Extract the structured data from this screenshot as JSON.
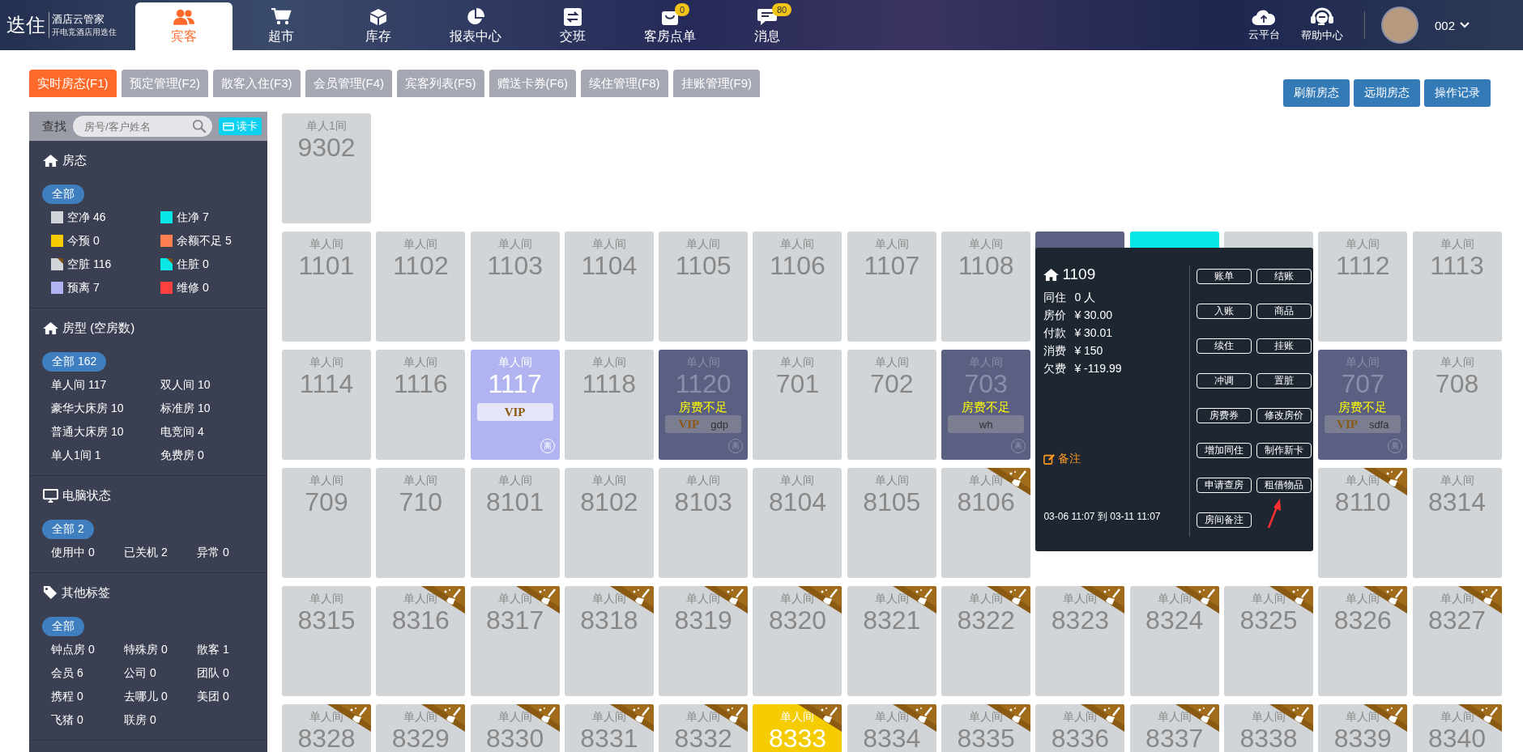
{
  "top_nav": {
    "logo": {
      "mark": "迭住",
      "name": "酒店云管家",
      "slogan": "开电竞酒店用迭住"
    },
    "items": [
      {
        "label": "宾客",
        "selected": true
      },
      {
        "label": "超市",
        "selected": false
      },
      {
        "label": "库存",
        "selected": false
      },
      {
        "label": "报表中心",
        "selected": false
      },
      {
        "label": "交班",
        "selected": false
      },
      {
        "label": "客房点单",
        "selected": false,
        "badge": "0"
      },
      {
        "label": "消息",
        "selected": false,
        "badge": "80"
      }
    ],
    "tools": [
      {
        "label": "云平台"
      },
      {
        "label": "帮助中心"
      }
    ],
    "user": {
      "name": "002"
    }
  },
  "tabs": [
    {
      "label": "实时房态(F1)",
      "selected": true
    },
    {
      "label": "预定管理(F2)",
      "selected": false
    },
    {
      "label": "散客入住(F3)",
      "selected": false
    },
    {
      "label": "会员管理(F4)",
      "selected": false
    },
    {
      "label": "宾客列表(F5)",
      "selected": false
    },
    {
      "label": "赠送卡券(F6)",
      "selected": false
    },
    {
      "label": "续住管理(F8)",
      "selected": false
    },
    {
      "label": "挂账管理(F9)",
      "selected": false
    }
  ],
  "actions": [
    "刷新房态",
    "远期房态",
    "操作记录"
  ],
  "sidebar": {
    "search": {
      "label": "查找",
      "placeholder": "房号/客户姓名"
    },
    "read_card": "读卡",
    "sections": [
      {
        "kind": "legend",
        "title": "房态",
        "all": {
          "label": "全部",
          "selected": true
        },
        "filters": [
          {
            "label": "空净 46",
            "color": "#d2d5d8",
            "dirty": false,
            "selected": false
          },
          {
            "label": "住净 7",
            "color": "#08e6e6",
            "dirty": false,
            "selected": false
          },
          {
            "label": "今预 0",
            "color": "#f5cc00",
            "dirty": false,
            "selected": false
          },
          {
            "label": "余额不足 5",
            "color": "#ff7f50",
            "dirty": false,
            "selected": false
          },
          {
            "label": "空脏 116",
            "color": "#d2d5d8",
            "dirty": true,
            "selected": false
          },
          {
            "label": "住脏 0",
            "color": "#08e6e6",
            "dirty": true,
            "selected": false
          },
          {
            "label": "预离 7",
            "color": "#b1b4f0",
            "dirty": false,
            "selected": false
          },
          {
            "label": "维修 0",
            "color": "#ff4040",
            "dirty": false,
            "selected": false
          }
        ]
      },
      {
        "kind": "types",
        "title": "房型 (空房数)",
        "all": {
          "label": "全部 162",
          "selected": true
        },
        "filters": [
          {
            "label": "单人间 117",
            "selected": false
          },
          {
            "label": "双人间 10",
            "selected": false
          },
          {
            "label": "豪华大床房 10",
            "selected": false
          },
          {
            "label": "标准房 10",
            "selected": false
          },
          {
            "label": "普通大床房 10",
            "selected": false
          },
          {
            "label": "电竞间 4",
            "selected": false
          },
          {
            "label": "单人1间 1",
            "selected": false
          },
          {
            "label": "免费房 0",
            "selected": false
          }
        ]
      },
      {
        "kind": "computers",
        "title": "电脑状态",
        "all": {
          "label": "全部 2",
          "selected": true
        },
        "filters": [
          {
            "label": "使用中 0",
            "selected": false
          },
          {
            "label": "已关机 2",
            "selected": false
          },
          {
            "label": "异常 0",
            "selected": false
          }
        ]
      },
      {
        "kind": "tags",
        "title": "其他标签",
        "all": {
          "label": "全部",
          "selected": true
        },
        "filters": [
          {
            "label": "钟点房 0",
            "selected": false
          },
          {
            "label": "特殊房 0",
            "selected": false
          },
          {
            "label": "散客 1",
            "selected": false
          },
          {
            "label": "会员 6",
            "selected": false
          },
          {
            "label": "公司 0",
            "selected": false
          },
          {
            "label": "团队 0",
            "selected": false
          },
          {
            "label": "携程 0",
            "selected": false
          },
          {
            "label": "去哪儿 0",
            "selected": false
          },
          {
            "label": "美团 0",
            "selected": false
          },
          {
            "label": "飞猪 0",
            "selected": false
          },
          {
            "label": "联房 0",
            "selected": false
          }
        ]
      }
    ]
  },
  "room_grid": {
    "rows": [
      [
        {
          "type": "单人1间",
          "number": "9302",
          "color": "#d2d5d8",
          "dirty": false
        }
      ],
      [
        {
          "type": "单人间",
          "number": "1101",
          "color": "#d2d5d8",
          "dirty": false
        },
        {
          "type": "单人间",
          "number": "1102",
          "color": "#d2d5d8",
          "dirty": false
        },
        {
          "type": "单人间",
          "number": "1103",
          "color": "#d2d5d8",
          "dirty": false
        },
        {
          "type": "单人间",
          "number": "1104",
          "color": "#d2d5d8",
          "dirty": false
        },
        {
          "type": "单人间",
          "number": "1105",
          "color": "#d2d5d8",
          "dirty": false
        },
        {
          "type": "单人间",
          "number": "1106",
          "color": "#d2d5d8",
          "dirty": false
        },
        {
          "type": "单人间",
          "number": "1107",
          "color": "#d2d5d8",
          "dirty": false
        },
        {
          "type": "单人间",
          "number": "1108",
          "color": "#d2d5d8",
          "dirty": false
        },
        {
          "color": "#5b5f82",
          "dirty": false
        },
        {
          "color": "#08e6e6",
          "dirty": false
        },
        {
          "color": "#d2d5d8",
          "dirty": false
        },
        {
          "type": "单人间",
          "number": "1112",
          "color": "#d2d5d8",
          "dirty": false
        },
        {
          "type": "单人间",
          "number": "1113",
          "color": "#d2d5d8",
          "dirty": false
        }
      ],
      [
        {
          "type": "单人间",
          "number": "1114",
          "color": "#d2d5d8",
          "dirty": false
        },
        {
          "type": "单人间",
          "number": "1116",
          "color": "#d2d5d8",
          "dirty": false
        },
        {
          "type": "单人间",
          "number": "1117",
          "color": "#b1b4f0",
          "dirty": false,
          "guest": {
            "tag": "VIP"
          },
          "badge": "离"
        },
        {
          "type": "单人间",
          "number": "1118",
          "color": "#d2d5d8",
          "dirty": false
        },
        {
          "type": "单人间",
          "number": "1120",
          "color": "#5b5f82",
          "dirty": false,
          "alert": "房费不足",
          "guest": {
            "tag": "VIP",
            "name": "gdp"
          },
          "badge": "离"
        },
        {
          "type": "单人间",
          "number": "701",
          "color": "#d2d5d8",
          "dirty": false
        },
        {
          "type": "单人间",
          "number": "702",
          "color": "#d2d5d8",
          "dirty": false
        },
        {
          "type": "单人间",
          "number": "703",
          "color": "#5b5f82",
          "dirty": false,
          "alert": "房费不足",
          "guest": {
            "name": "wh"
          },
          "badge": "离"
        },
        {
          "type": "单人间",
          "number": "707",
          "color": "#5b5f82",
          "dirty": false,
          "alert": "房费不足",
          "guest": {
            "tag": "VIP",
            "name": "sdfa"
          },
          "badge": "离"
        },
        {
          "type": "单人间",
          "number": "708",
          "color": "#d2d5d8",
          "dirty": false
        }
      ],
      [
        {
          "type": "单人间",
          "number": "709",
          "color": "#d2d5d8",
          "dirty": false
        },
        {
          "type": "单人间",
          "number": "710",
          "color": "#d2d5d8",
          "dirty": false
        },
        {
          "type": "单人间",
          "number": "8101",
          "color": "#d2d5d8",
          "dirty": false
        },
        {
          "type": "单人间",
          "number": "8102",
          "color": "#d2d5d8",
          "dirty": false
        },
        {
          "type": "单人间",
          "number": "8103",
          "color": "#d2d5d8",
          "dirty": false
        },
        {
          "type": "单人间",
          "number": "8104",
          "color": "#d2d5d8",
          "dirty": false
        },
        {
          "type": "单人间",
          "number": "8105",
          "color": "#d2d5d8",
          "dirty": false
        },
        {
          "type": "单人间",
          "number": "8106",
          "color": "#d2d5d8",
          "dirty": true
        },
        {
          "type": "单人间",
          "number": "8110",
          "color": "#d2d5d8",
          "dirty": true
        },
        {
          "type": "单人间",
          "number": "8314",
          "color": "#d2d5d8",
          "dirty": false
        }
      ],
      [
        {
          "type": "单人间",
          "number": "8315",
          "color": "#d2d5d8",
          "dirty": false
        },
        {
          "type": "单人间",
          "number": "8316",
          "color": "#d2d5d8",
          "dirty": true
        },
        {
          "type": "单人间",
          "number": "8317",
          "color": "#d2d5d8",
          "dirty": true
        },
        {
          "type": "单人间",
          "number": "8318",
          "color": "#d2d5d8",
          "dirty": true
        },
        {
          "type": "单人间",
          "number": "8319",
          "color": "#d2d5d8",
          "dirty": true
        },
        {
          "type": "单人间",
          "number": "8320",
          "color": "#d2d5d8",
          "dirty": true
        },
        {
          "type": "单人间",
          "number": "8321",
          "color": "#d2d5d8",
          "dirty": true
        },
        {
          "type": "单人间",
          "number": "8322",
          "color": "#d2d5d8",
          "dirty": true
        },
        {
          "type": "单人间",
          "number": "8323",
          "color": "#d2d5d8",
          "dirty": true
        },
        {
          "type": "单人间",
          "number": "8324",
          "color": "#d2d5d8",
          "dirty": true
        },
        {
          "type": "单人间",
          "number": "8325",
          "color": "#d2d5d8",
          "dirty": true
        },
        {
          "type": "单人间",
          "number": "8326",
          "color": "#d2d5d8",
          "dirty": true
        },
        {
          "type": "单人间",
          "number": "8327",
          "color": "#d2d5d8",
          "dirty": true
        }
      ],
      [
        {
          "type": "单人间",
          "number": "8328",
          "color": "#d2d5d8",
          "dirty": true
        },
        {
          "type": "单人间",
          "number": "8329",
          "color": "#d2d5d8",
          "dirty": true
        },
        {
          "type": "单人间",
          "number": "8330",
          "color": "#d2d5d8",
          "dirty": true
        },
        {
          "type": "单人间",
          "number": "8331",
          "color": "#d2d5d8",
          "dirty": true
        },
        {
          "type": "单人间",
          "number": "8332",
          "color": "#d2d5d8",
          "dirty": true
        },
        {
          "type": "单人间",
          "number": "8333",
          "color": "#f5cc00",
          "dirty": true
        },
        {
          "type": "单人间",
          "number": "8334",
          "color": "#d2d5d8",
          "dirty": true
        },
        {
          "type": "单人间",
          "number": "8335",
          "color": "#d2d5d8",
          "dirty": true
        },
        {
          "type": "单人间",
          "number": "8336",
          "color": "#d2d5d8",
          "dirty": true
        },
        {
          "type": "单人间",
          "number": "8337",
          "color": "#d2d5d8",
          "dirty": true
        },
        {
          "type": "单人间",
          "number": "8338",
          "color": "#d2d5d8",
          "dirty": true
        },
        {
          "type": "单人间",
          "number": "8339",
          "color": "#d2d5d8",
          "dirty": true
        },
        {
          "type": "单人间",
          "number": "8340",
          "color": "#d2d5d8",
          "dirty": true
        }
      ]
    ]
  },
  "room_popup": {
    "room": "1109",
    "facts": [
      {
        "label": "同住",
        "value": "0 人"
      },
      {
        "label": "房价",
        "value": "¥ 30.00"
      },
      {
        "label": "付款",
        "value": "¥ 30.01"
      },
      {
        "label": "消费",
        "value": "¥ 150"
      },
      {
        "label": "欠费",
        "value": "¥ -119.99"
      }
    ],
    "note": "备注",
    "stay": "03-06 11:07 到 03-11 11:07",
    "buttons": [
      "账单",
      "结账",
      "入账",
      "商品",
      "续住",
      "挂账",
      "冲调",
      "置脏",
      "房费券",
      "修改房价",
      "增加同住",
      "制作新卡",
      "申请查房",
      "租借物品",
      "房间备注"
    ]
  }
}
